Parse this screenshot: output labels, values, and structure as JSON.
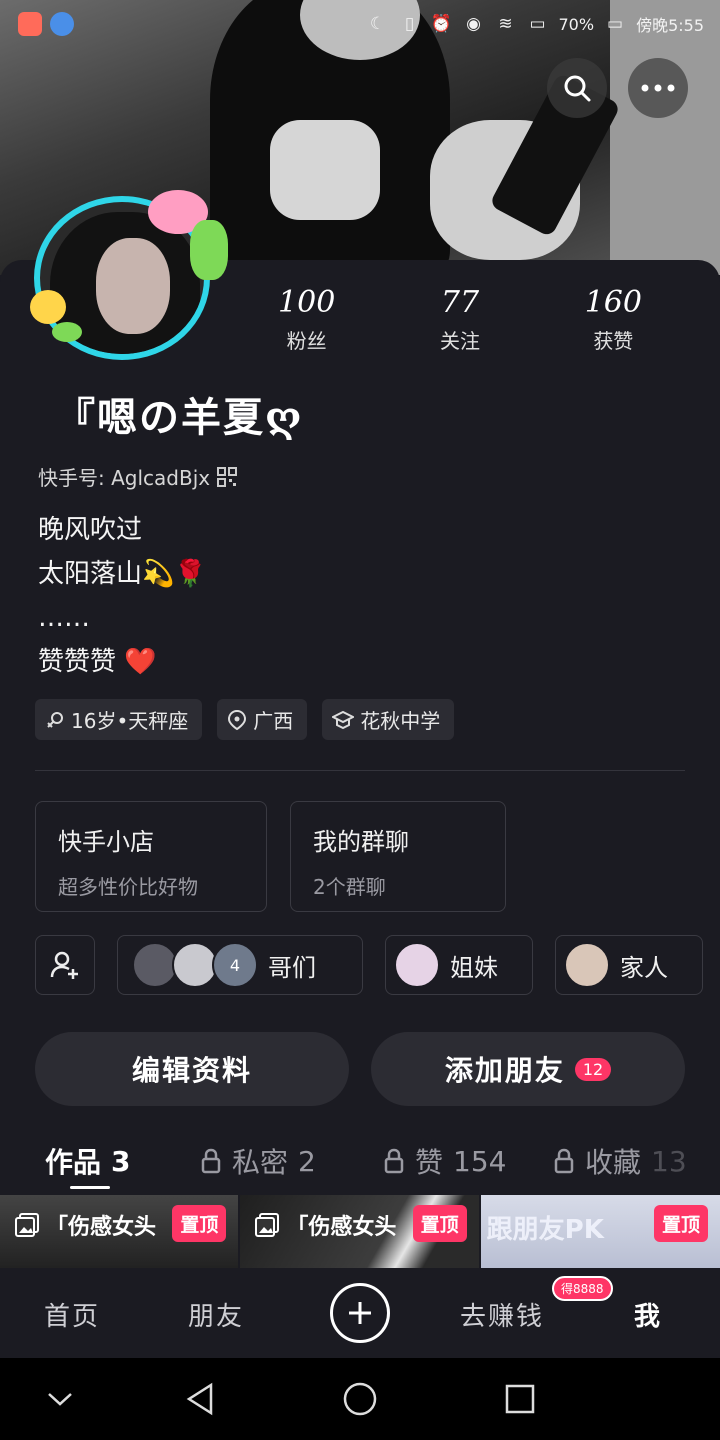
{
  "status_bar": {
    "battery": "70%",
    "time": "傍晚5:55"
  },
  "profile": {
    "stats": [
      {
        "value": "100",
        "label": "粉丝"
      },
      {
        "value": "77",
        "label": "关注"
      },
      {
        "value": "160",
        "label": "获赞"
      }
    ],
    "nickname": "『嗯の羊夏ღ",
    "kuaishou_id_label": "快手号: AglcadBjx",
    "bio": [
      "晚风吹过",
      "太阳落山💫🌹",
      "……",
      "赞赞赞 ❤️"
    ],
    "tags": [
      "16岁•天秤座",
      "广西",
      "花秋中学"
    ]
  },
  "cards": [
    {
      "title": "快手小店",
      "subtitle": "超多性价比好物"
    },
    {
      "title": "我的群聊",
      "subtitle": "2个群聊"
    }
  ],
  "groups": [
    {
      "name": "哥们",
      "extra_count": "4"
    },
    {
      "name": "姐妹"
    },
    {
      "name": "家人"
    }
  ],
  "buttons": {
    "edit_profile": "编辑资料",
    "add_friend": "添加朋友",
    "add_friend_badge": "12"
  },
  "tabs": [
    {
      "label": "作品",
      "count": "3"
    },
    {
      "label": "私密",
      "count": "2"
    },
    {
      "label": "赞",
      "count": "154"
    },
    {
      "label": "收藏",
      "count": "13"
    }
  ],
  "works": [
    {
      "title": "「伤感女头",
      "pin": "置顶"
    },
    {
      "title": "「伤感女头",
      "pin": "置顶"
    },
    {
      "title": "跟朋友PK",
      "pin": "置顶"
    }
  ],
  "bottom_nav": {
    "home": "首页",
    "friends": "朋友",
    "earn": "去赚钱",
    "earn_badge": "得8888",
    "me": "我"
  },
  "colors": {
    "background": "#1b1b22",
    "accent_red": "#fe3666",
    "avatar_ring": "#2fd6e8",
    "chip_bg": "#2c2c33"
  }
}
